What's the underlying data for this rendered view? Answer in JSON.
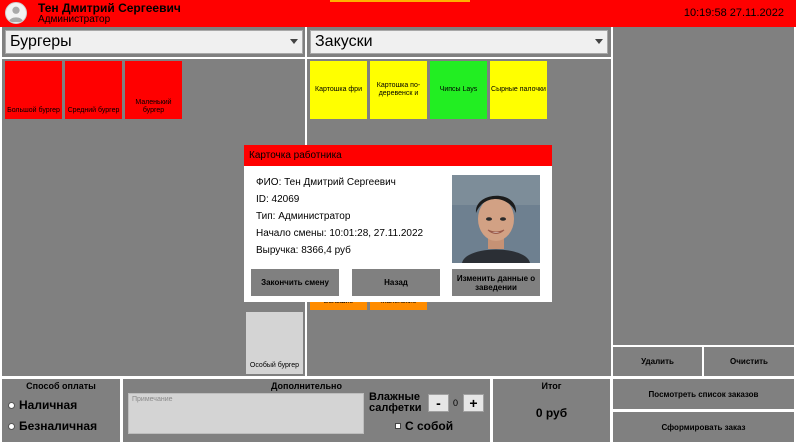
{
  "header": {
    "user_name": "Тен Дмитрий Сергеевич",
    "user_role": "Администратор",
    "clock": "10:19:58  27.11.2022"
  },
  "left_panel": {
    "category": "Бургеры",
    "items": [
      {
        "label": "Большой бургер",
        "color": "#ff0000"
      },
      {
        "label": "Средний бургер",
        "color": "#ff0000"
      },
      {
        "label": "Маленький бургер",
        "color": "#ff0000"
      }
    ],
    "special_item": {
      "label": "Особый бургер",
      "color": "#d4d4d4"
    }
  },
  "mid_panel": {
    "category": "Закуски",
    "items": [
      {
        "label": "Картошка фри",
        "color": "#ffff00"
      },
      {
        "label": "Картошка по-деревенск и",
        "color": "#ffff00"
      },
      {
        "label": "Чипсы Lays",
        "color": "#22ee22"
      },
      {
        "label": "Сырные палочки",
        "color": "#ffff00"
      }
    ],
    "partial_items": [
      {
        "label": "Большие",
        "color": "#ff8c00"
      },
      {
        "label": "Маленькие",
        "color": "#ff8c00"
      }
    ]
  },
  "right_panel": {
    "delete_label": "Удалить",
    "clear_label": "Очистить",
    "view_orders_label": "Посмотреть список заказов",
    "make_order_label": "Сформировать заказ"
  },
  "payment": {
    "title": "Способ оплаты",
    "options": [
      "Наличная",
      "Безналичная"
    ]
  },
  "extra": {
    "title": "Дополнительно",
    "notes_placeholder": "Примечание",
    "napkins_label": "Влажные салфетки",
    "minus": "-",
    "plus": "+",
    "count": "0",
    "takeaway_label": "С собой"
  },
  "total": {
    "title": "Итог",
    "value": "0 руб"
  },
  "modal": {
    "title": "Карточка работника",
    "fio": "ФИО: Тен Дмитрий Сергеевич",
    "id": "ID: 42069",
    "type": "Тип: Администратор",
    "shift_start": "Начало смены: 10:01:28, 27.11.2022",
    "revenue": "Выручка: 8366,4 руб",
    "end_shift_label": "Закончить смену",
    "back_label": "Назад",
    "edit_label": "Изменить данные о заведении"
  },
  "colors": {
    "accent": "#ff0000",
    "panel": "#808080",
    "yellow": "#ffff00",
    "green": "#22ee22",
    "orange": "#ff8c00"
  }
}
